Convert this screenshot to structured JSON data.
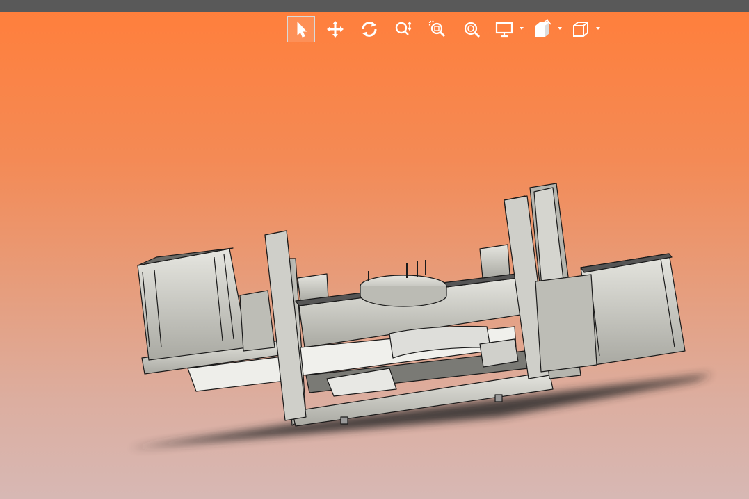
{
  "window": {
    "titlebar_color": "#595959"
  },
  "viewport": {
    "background_top": "#ff7f3c",
    "background_bottom": "#d7b8b4"
  },
  "toolbar": {
    "items": [
      {
        "name": "select-tool",
        "icon": "cursor-arrow-icon",
        "active": true
      },
      {
        "name": "pan-tool",
        "icon": "move-arrows-icon",
        "active": false
      },
      {
        "name": "rotate-tool",
        "icon": "rotate-icon",
        "active": false
      },
      {
        "name": "zoom-tool",
        "icon": "zoom-icon",
        "active": false
      },
      {
        "name": "zoom-window-tool",
        "icon": "zoom-window-icon",
        "active": false
      },
      {
        "name": "zoom-fit-tool",
        "icon": "zoom-fit-icon",
        "active": false
      },
      {
        "name": "display-mode-dropdown",
        "icon": "monitor-icon",
        "active": false
      },
      {
        "name": "section-view-dropdown",
        "icon": "section-view-icon",
        "active": false
      },
      {
        "name": "view-orientation-dropdown",
        "icon": "cube-icon",
        "active": false
      }
    ]
  },
  "scene": {
    "part_color": "#c8c8c0",
    "shadow_color": "#2a2a2a"
  }
}
